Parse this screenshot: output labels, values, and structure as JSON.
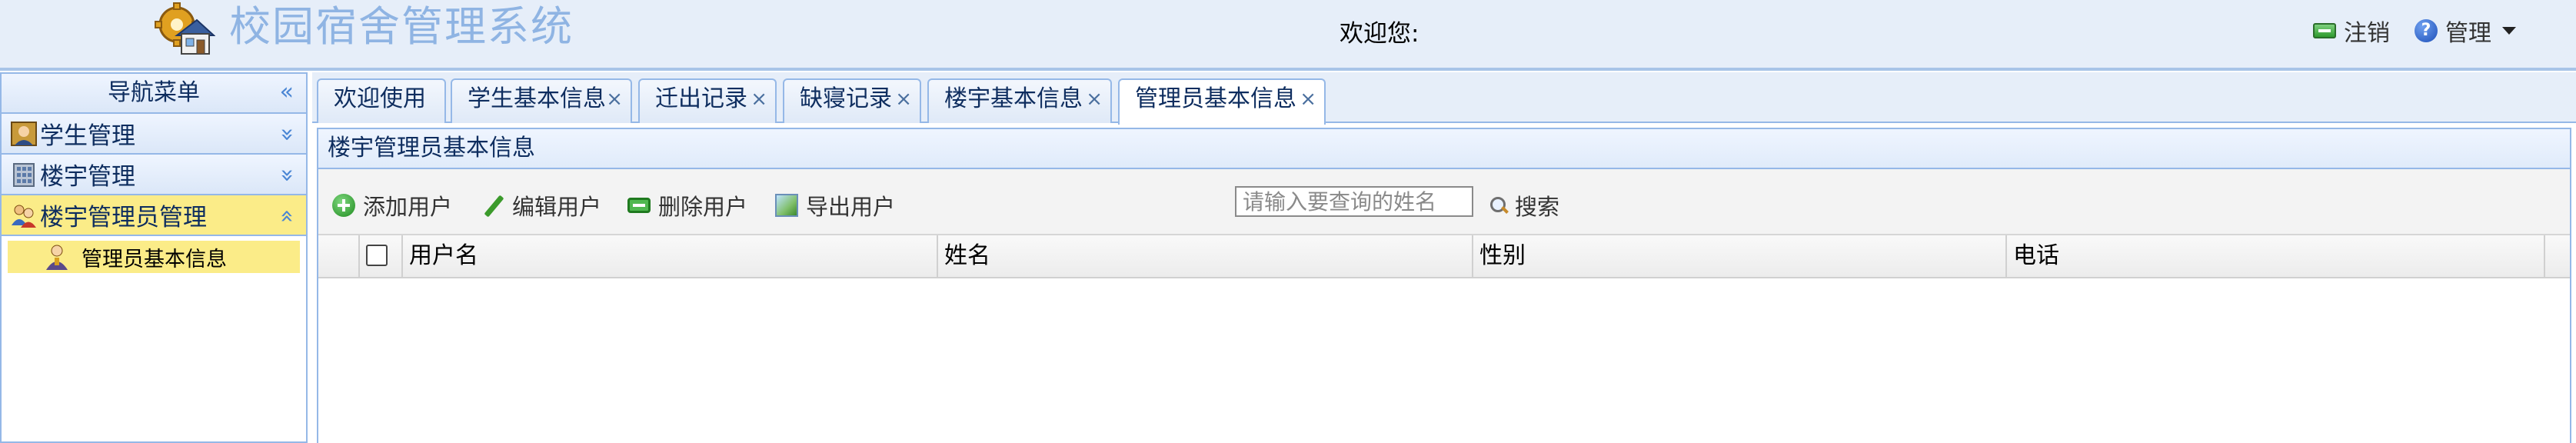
{
  "header": {
    "title": "校园宿舍管理系统",
    "welcome": "欢迎您:",
    "logout_label": "注销",
    "manage_label": "管理"
  },
  "sidebar": {
    "title": "导航菜单",
    "items": [
      {
        "label": "学生管理",
        "expanded": false
      },
      {
        "label": "楼宇管理",
        "expanded": false
      },
      {
        "label": "楼宇管理员管理",
        "expanded": true,
        "children": [
          {
            "label": "管理员基本信息"
          }
        ]
      }
    ]
  },
  "tabs": [
    {
      "label": "欢迎使用",
      "closable": false
    },
    {
      "label": "学生基本信息",
      "closable": true
    },
    {
      "label": "迁出记录",
      "closable": true
    },
    {
      "label": "缺寝记录",
      "closable": true
    },
    {
      "label": "楼宇基本信息",
      "closable": true
    },
    {
      "label": "管理员基本信息",
      "closable": true,
      "active": true
    }
  ],
  "panel": {
    "title": "楼宇管理员基本信息",
    "toolbar": {
      "add": "添加用户",
      "edit": "编辑用户",
      "delete": "删除用户",
      "export": "导出用户",
      "search_placeholder": "请输入要查询的姓名",
      "search": "搜索"
    },
    "columns": [
      "用户名",
      "姓名",
      "性别",
      "电话"
    ],
    "rows": []
  },
  "colors": {
    "header_bg": "#e6eef9",
    "title_color": "#8fb4e3",
    "border": "#95b8e7",
    "highlight": "#fbec88"
  }
}
